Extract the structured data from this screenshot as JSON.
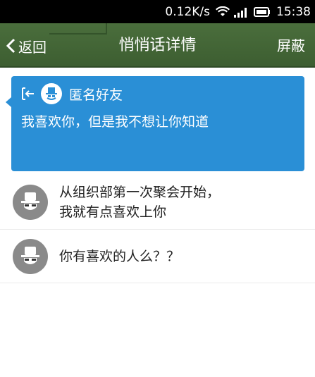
{
  "status_bar": {
    "speed": "0.12K/s",
    "time": "15:38",
    "icons": [
      "wifi-icon",
      "signal-icon",
      "battery-icon"
    ]
  },
  "title_bar": {
    "back_label": "返回",
    "title": "悄悄话详情",
    "block_label": "屏蔽"
  },
  "message": {
    "sender": "匿名好友",
    "text": "我喜欢你，但是我不想让你知道"
  },
  "replies": [
    {
      "lines": [
        "从组织部第一次聚会开始，",
        "我就有点喜欢上你"
      ]
    },
    {
      "lines": [
        "你有喜欢的人么？？"
      ]
    }
  ],
  "colors": {
    "title_bar": "#3d5e31",
    "card": "#2a8fd6",
    "avatar_gray": "#8a8a8a"
  }
}
